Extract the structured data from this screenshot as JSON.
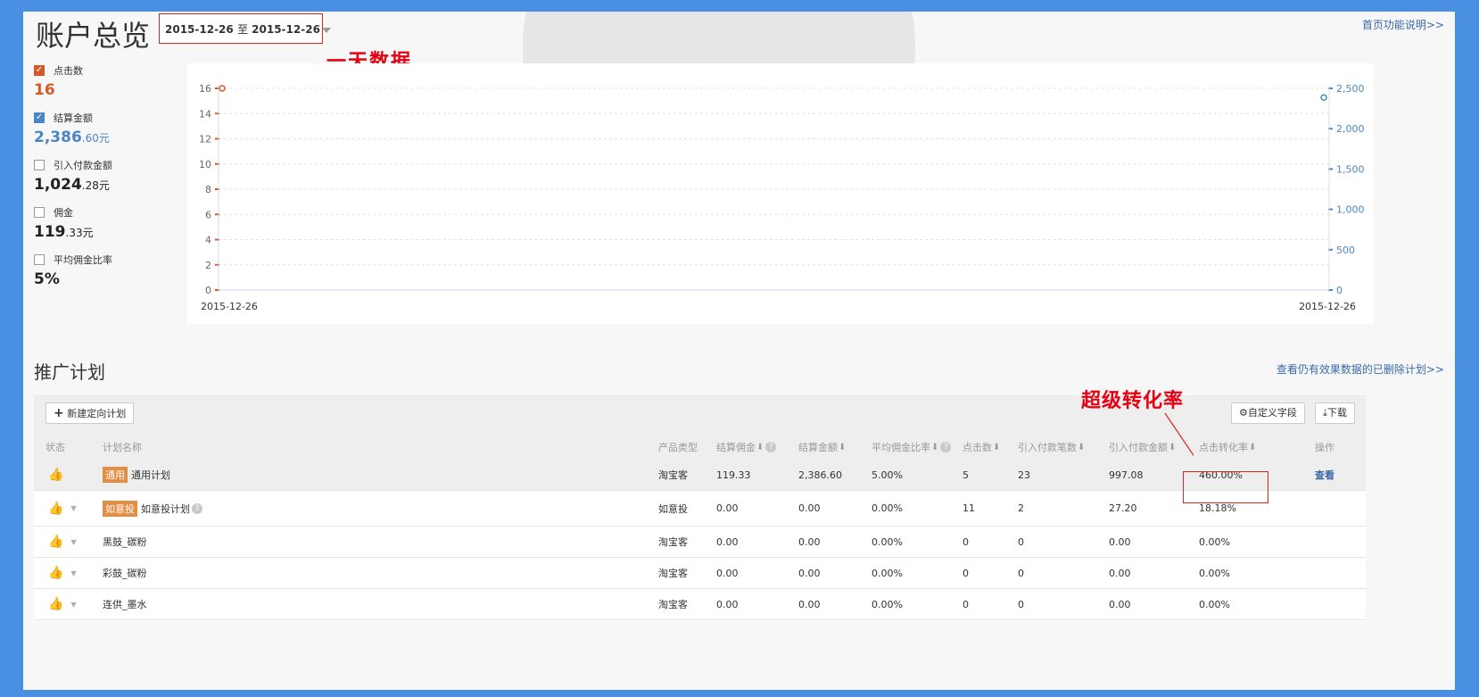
{
  "header": {
    "title": "账户总览",
    "date_start": "2015-12-26",
    "date_sep": "至",
    "date_end": "2015-12-26",
    "annotation": "一天数据",
    "help_link": "首页功能说明>>"
  },
  "metrics": [
    {
      "label": "点击数",
      "checked": true,
      "check_color": "#d4582a",
      "value_main": "16",
      "value_small": "",
      "value_color": "#d4582a"
    },
    {
      "label": "结算金额",
      "checked": true,
      "check_color": "#4a86c5",
      "value_main": "2,386",
      "value_small": ".60元",
      "value_color": "#4a86c5"
    },
    {
      "label": "引入付款金额",
      "checked": false,
      "value_main": "1,024",
      "value_small": ".28元",
      "value_color": "#222222"
    },
    {
      "label": "佣金",
      "checked": false,
      "value_main": "119",
      "value_small": ".33元",
      "value_color": "#222222"
    },
    {
      "label": "平均佣金比率",
      "checked": false,
      "value_main": "5%",
      "value_small": "",
      "value_color": "#222222"
    }
  ],
  "chart_data": {
    "type": "line",
    "x": [
      "2015-12-26"
    ],
    "x_tick_left": "2015-12-26",
    "x_tick_right": "2015-12-26",
    "y_left": {
      "ticks": [
        "0",
        "2",
        "4",
        "6",
        "8",
        "10",
        "12",
        "14",
        "16"
      ],
      "range": [
        0,
        16
      ],
      "color": "#d4582a"
    },
    "y_right": {
      "ticks": [
        "0",
        "500",
        "1,000",
        "1,500",
        "2,000",
        "2,500"
      ],
      "range": [
        0,
        2500
      ],
      "color": "#4a86c5"
    },
    "series": [
      {
        "name": "点击数",
        "axis": "left",
        "values": [
          16
        ],
        "color": "#d4582a"
      },
      {
        "name": "结算金额",
        "axis": "right",
        "values": [
          2386.6
        ],
        "color": "#4a86c5"
      }
    ],
    "grid": true
  },
  "plans": {
    "title": "推广计划",
    "deleted_link": "查看仍有效果数据的已删除计划>>",
    "new_button": "新建定向计划",
    "custom_button": "自定义字段",
    "download_button": "下载",
    "annotation": "超级转化率",
    "columns": {
      "status": "状态",
      "name": "计划名称",
      "type": "产品类型",
      "commission": "结算佣金",
      "amount": "结算金额",
      "ratio": "平均佣金比率",
      "clicks": "点击数",
      "orders": "引入付款笔数",
      "paid": "引入付款金额",
      "cvr": "点击转化率",
      "action": "操作"
    },
    "rows": [
      {
        "tag": "通用",
        "name": "通用计划",
        "type": "淘宝客",
        "commission": "119.33",
        "amount": "2,386.60",
        "ratio": "5.00%",
        "clicks": "5",
        "orders": "23",
        "paid": "997.08",
        "cvr": "460.00%",
        "action": "查看"
      },
      {
        "tag": "如意投",
        "name": "如意投计划",
        "type": "如意投",
        "commission": "0.00",
        "amount": "0.00",
        "ratio": "0.00%",
        "clicks": "11",
        "orders": "2",
        "paid": "27.20",
        "cvr": "18.18%",
        "action": ""
      },
      {
        "tag": "",
        "name": "黑鼓_碳粉",
        "type": "淘宝客",
        "commission": "0.00",
        "amount": "0.00",
        "ratio": "0.00%",
        "clicks": "0",
        "orders": "0",
        "paid": "0.00",
        "cvr": "0.00%",
        "action": ""
      },
      {
        "tag": "",
        "name": "彩鼓_碳粉",
        "type": "淘宝客",
        "commission": "0.00",
        "amount": "0.00",
        "ratio": "0.00%",
        "clicks": "0",
        "orders": "0",
        "paid": "0.00",
        "cvr": "0.00%",
        "action": ""
      },
      {
        "tag": "",
        "name": "连供_墨水",
        "type": "淘宝客",
        "commission": "0.00",
        "amount": "0.00",
        "ratio": "0.00%",
        "clicks": "0",
        "orders": "0",
        "paid": "0.00",
        "cvr": "0.00%",
        "action": ""
      }
    ]
  }
}
